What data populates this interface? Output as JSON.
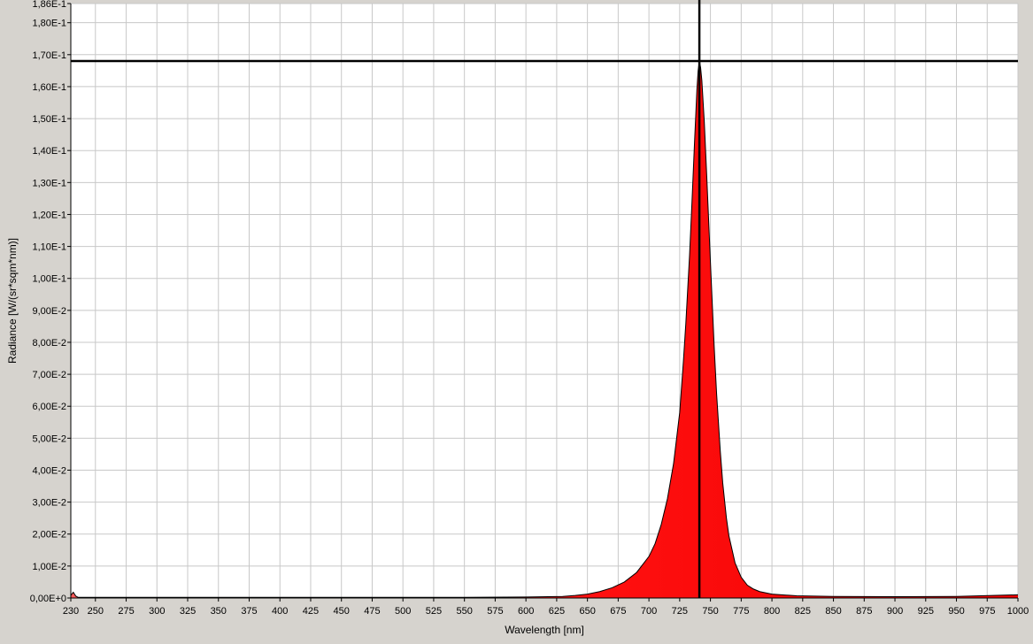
{
  "chart_data": {
    "type": "area",
    "title": "",
    "xlabel": "Wavelength [nm]",
    "ylabel": "Radiance [W/(sr*sqm*nm)]",
    "xlim": [
      230,
      1000
    ],
    "ylim": [
      0,
      0.186
    ],
    "x_ticks": [
      230,
      250,
      275,
      300,
      325,
      350,
      375,
      400,
      425,
      450,
      475,
      500,
      525,
      550,
      575,
      600,
      625,
      650,
      675,
      700,
      725,
      750,
      775,
      800,
      825,
      850,
      875,
      900,
      925,
      950,
      975,
      1000
    ],
    "y_ticks": [
      {
        "value": 0,
        "label": "0,00E+0"
      },
      {
        "value": 0.01,
        "label": "1,00E-2"
      },
      {
        "value": 0.02,
        "label": "2,00E-2"
      },
      {
        "value": 0.03,
        "label": "3,00E-2"
      },
      {
        "value": 0.04,
        "label": "4,00E-2"
      },
      {
        "value": 0.05,
        "label": "5,00E-2"
      },
      {
        "value": 0.06,
        "label": "6,00E-2"
      },
      {
        "value": 0.07,
        "label": "7,00E-2"
      },
      {
        "value": 0.08,
        "label": "8,00E-2"
      },
      {
        "value": 0.09,
        "label": "9,00E-2"
      },
      {
        "value": 0.1,
        "label": "1,00E-1"
      },
      {
        "value": 0.11,
        "label": "1,10E-1"
      },
      {
        "value": 0.12,
        "label": "1,20E-1"
      },
      {
        "value": 0.13,
        "label": "1,30E-1"
      },
      {
        "value": 0.14,
        "label": "1,40E-1"
      },
      {
        "value": 0.15,
        "label": "1,50E-1"
      },
      {
        "value": 0.16,
        "label": "1,60E-1"
      },
      {
        "value": 0.17,
        "label": "1,70E-1"
      },
      {
        "value": 0.18,
        "label": "1,80E-1"
      },
      {
        "value": 0.186,
        "label": "1,86E-1"
      }
    ],
    "grid": true,
    "fill_color": "#ff0000",
    "cursor": {
      "x": 741,
      "y": 0.168,
      "color": "#000000"
    },
    "series": [
      {
        "x": [
          230,
          232,
          234,
          236,
          260,
          300,
          350,
          400,
          450,
          500,
          550,
          600,
          630,
          640,
          650,
          660,
          670,
          680,
          690,
          700,
          705,
          710,
          715,
          720,
          725,
          728,
          730,
          733,
          735,
          737,
          739,
          740,
          741,
          742,
          743,
          745,
          747,
          750,
          753,
          755,
          758,
          760,
          763,
          765,
          770,
          775,
          780,
          785,
          790,
          800,
          820,
          850,
          900,
          950,
          1000
        ],
        "values": [
          0.0008,
          0.0018,
          0.0006,
          0.0002,
          0.0002,
          0.0002,
          0.0002,
          0.0002,
          0.0002,
          0.0002,
          0.0002,
          0.0003,
          0.0005,
          0.0008,
          0.0012,
          0.002,
          0.0032,
          0.005,
          0.008,
          0.013,
          0.017,
          0.023,
          0.031,
          0.042,
          0.058,
          0.074,
          0.086,
          0.107,
          0.124,
          0.142,
          0.159,
          0.165,
          0.168,
          0.166,
          0.162,
          0.149,
          0.132,
          0.105,
          0.079,
          0.064,
          0.046,
          0.036,
          0.025,
          0.0195,
          0.011,
          0.0065,
          0.004,
          0.0028,
          0.002,
          0.0012,
          0.0007,
          0.0005,
          0.0004,
          0.0005,
          0.001
        ]
      }
    ]
  }
}
